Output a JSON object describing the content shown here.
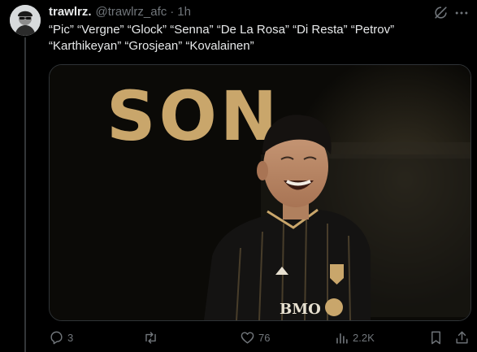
{
  "author": {
    "display_name": "trawlrz.",
    "handle": "@trawlrz_afc",
    "separator": "·",
    "time": "1h"
  },
  "tweet": {
    "text": "“Pic” “Vergne” “Glock” “Senna” “De La Rosa” “Di Resta” “Petrov” “Karthikeyan” “Grosjean” “Kovalainen”"
  },
  "media": {
    "headline": "SON",
    "shirt_text": "BMO",
    "colors": {
      "background": "#0b0a07",
      "headline_gold": "#c9a66b",
      "jersey": "#141312"
    }
  },
  "actions": {
    "reply": {
      "icon": "reply-icon",
      "count": "3"
    },
    "retweet": {
      "icon": "retweet-icon",
      "count": ""
    },
    "like": {
      "icon": "heart-icon",
      "count": "76"
    },
    "views": {
      "icon": "views-icon",
      "count": "2.2K"
    },
    "bookmark": {
      "icon": "bookmark-icon"
    },
    "share": {
      "icon": "share-icon"
    }
  },
  "colors": {
    "background": "#000000",
    "text": "#e7e9ea",
    "muted": "#71767b",
    "border": "#2f3336"
  }
}
